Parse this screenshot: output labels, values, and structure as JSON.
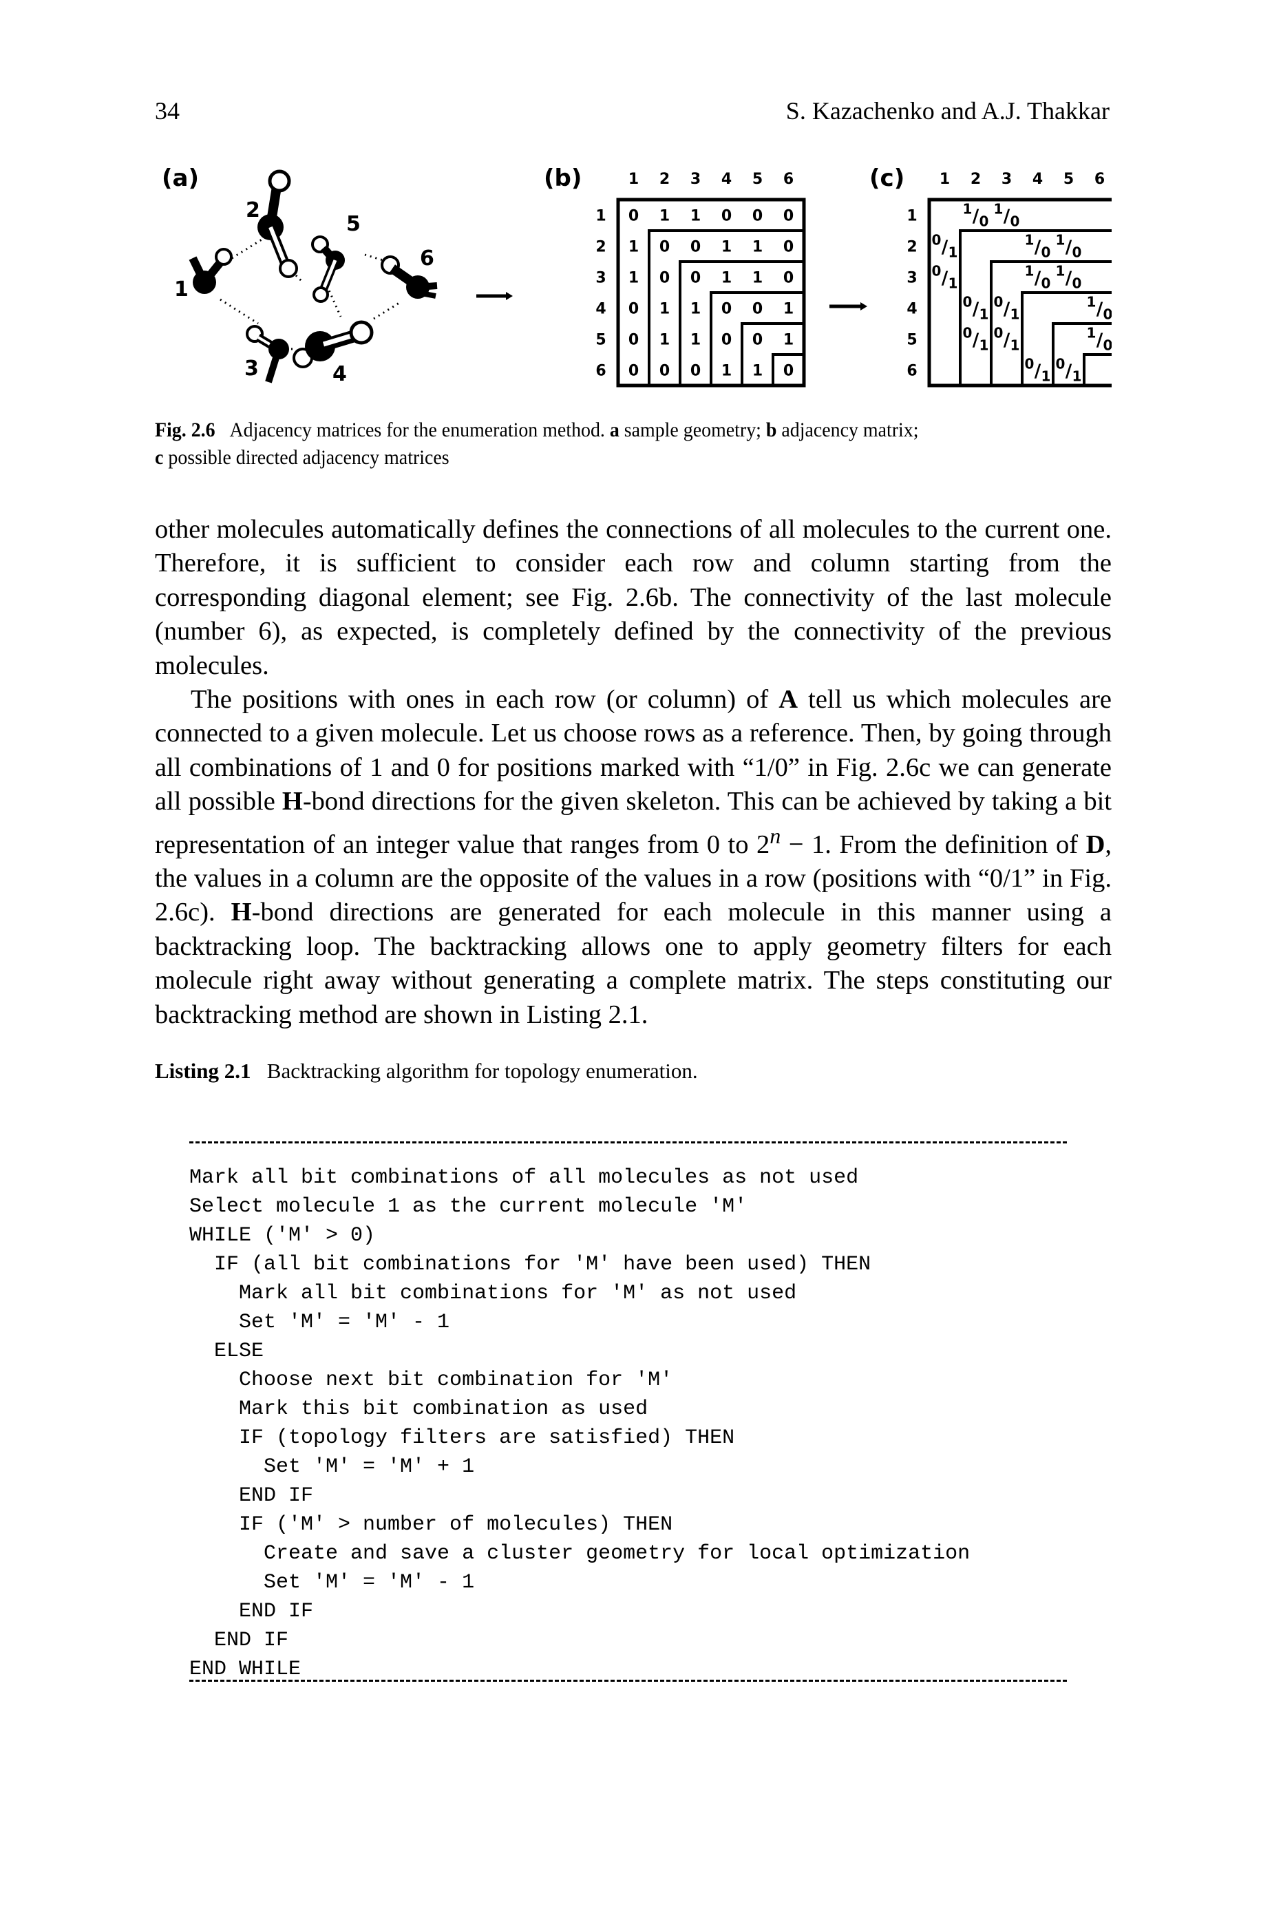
{
  "header": {
    "page_number": "34",
    "running_head": "S. Kazachenko and A.J. Thakkar"
  },
  "figure": {
    "panel_a": {
      "label": "(a)",
      "molecule_labels": [
        "1",
        "2",
        "3",
        "4",
        "5",
        "6"
      ]
    },
    "panel_b": {
      "label": "(b)",
      "column_headers": [
        "1",
        "2",
        "3",
        "4",
        "5",
        "6"
      ],
      "row_headers": [
        "1",
        "2",
        "3",
        "4",
        "5",
        "6"
      ],
      "matrix": [
        [
          "0",
          "1",
          "1",
          "0",
          "0",
          "0"
        ],
        [
          "1",
          "0",
          "0",
          "1",
          "1",
          "0"
        ],
        [
          "1",
          "0",
          "0",
          "1",
          "1",
          "0"
        ],
        [
          "0",
          "1",
          "1",
          "0",
          "0",
          "1"
        ],
        [
          "0",
          "1",
          "1",
          "0",
          "0",
          "1"
        ],
        [
          "0",
          "0",
          "0",
          "1",
          "1",
          "0"
        ]
      ]
    },
    "panel_c": {
      "label": "(c)",
      "column_headers": [
        "1",
        "2",
        "3",
        "4",
        "5",
        "6"
      ],
      "row_headers": [
        "1",
        "2",
        "3",
        "4",
        "5",
        "6"
      ],
      "matrix": [
        [
          "",
          "1/0",
          "1/0",
          "",
          "",
          ""
        ],
        [
          "0/1",
          "",
          "",
          "1/0",
          "1/0",
          ""
        ],
        [
          "0/1",
          "",
          "",
          "1/0",
          "1/0",
          ""
        ],
        [
          "",
          "0/1",
          "0/1",
          "",
          "",
          "1/0"
        ],
        [
          "",
          "0/1",
          "0/1",
          "",
          "",
          "1/0"
        ],
        [
          "",
          "",
          "",
          "0/1",
          "0/1",
          ""
        ]
      ]
    },
    "caption": {
      "label": "Fig. 2.6",
      "text_1": "Adjacency matrices for the enumeration method.",
      "a_key": "a",
      "a_text": "sample geometry;",
      "b_key": "b",
      "b_text": "adjacency matrix;",
      "c_key": "c",
      "c_text": "possible directed adjacency matrices"
    }
  },
  "body": {
    "p1": "other molecules automatically defines the connections of all molecules to the current one. Therefore, it is sufficient to consider each row and column starting from the corresponding diagonal element; see Fig. 2.6b. The connectivity of the last molecule (number 6), as expected, is completely defined by the connectivity of the previous molecules.",
    "p2_a": "The positions with ones in each row (or column) of ",
    "p2_A": "A",
    "p2_b": " tell us which molecules are connected to a given molecule. Let us choose rows as a reference. Then, by going through all combinations of 1 and 0 for positions marked with “1/0” in Fig. 2.6c we can generate all possible ",
    "p2_hbond1": "H",
    "p2_c": "-bond directions for the given skeleton. This can be achieved by taking a bit representation of an integer value that ranges from 0 to 2",
    "p2_sup": "n",
    "p2_d": " − 1. From the definition of ",
    "p2_D": "D",
    "p2_e": ", the values in a column are the opposite of the values in a row (positions with “0/1” in Fig. 2.6c). ",
    "p2_hbond2": "H",
    "p2_f": "-bond directions are generated for each molecule in this manner using a backtracking loop. The backtracking allows one to apply geometry filters for each molecule right away without generating a complete matrix. The steps constituting our backtracking method are shown in Listing 2.1."
  },
  "listing": {
    "label": "Listing 2.1",
    "title": "Backtracking algorithm for topology enumeration.",
    "lines": [
      "Mark all bit combinations of all molecules as not used",
      "Select molecule 1 as the current molecule 'M'",
      "WHILE ('M' > 0)",
      "  IF (all bit combinations for 'M' have been used) THEN",
      "    Mark all bit combinations for 'M' as not used",
      "    Set 'M' = 'M' - 1",
      "  ELSE",
      "    Choose next bit combination for 'M'",
      "    Mark this bit combination as used",
      "    IF (topology filters are satisfied) THEN",
      "      Set 'M' = 'M' + 1",
      "    END IF",
      "    IF ('M' > number of molecules) THEN",
      "      Create and save a cluster geometry for local optimization",
      "      Set 'M' = 'M' - 1",
      "    END IF",
      "  END IF",
      "END WHILE"
    ]
  }
}
